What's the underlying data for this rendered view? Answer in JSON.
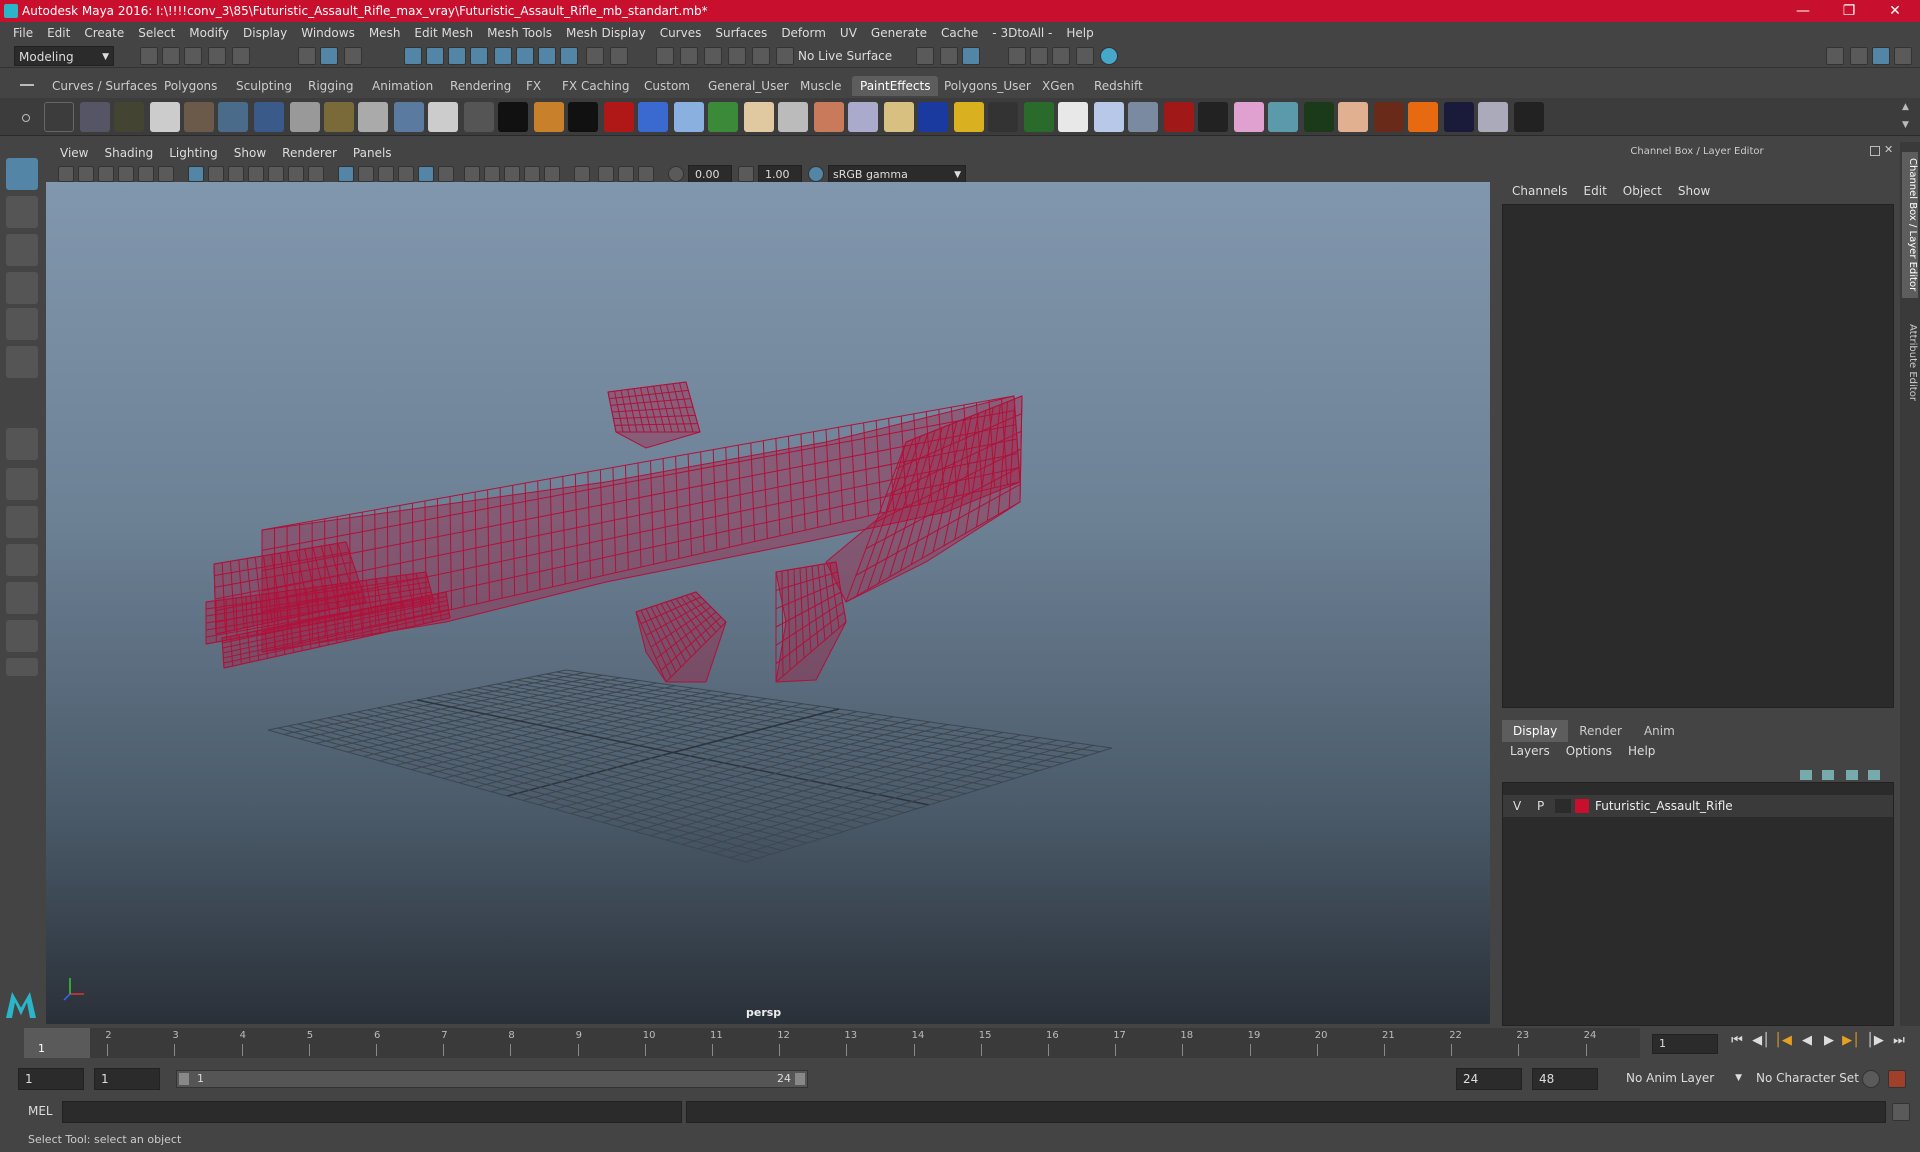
{
  "window": {
    "title": "Autodesk Maya 2016: I:\\!!!!conv_3\\85\\Futuristic_Assault_Rifle_max_vray\\Futuristic_Assault_Rifle_mb_standart.mb*"
  },
  "menus": [
    "File",
    "Edit",
    "Create",
    "Select",
    "Modify",
    "Display",
    "Windows",
    "Mesh",
    "Edit Mesh",
    "Mesh Tools",
    "Mesh Display",
    "Curves",
    "Surfaces",
    "Deform",
    "UV",
    "Generate",
    "Cache",
    "- 3DtoAll -",
    "Help"
  ],
  "statusline": {
    "mode": "Modeling",
    "live_surface": "No Live Surface"
  },
  "shelf_tabs": [
    "Curves / Surfaces",
    "Polygons",
    "Sculpting",
    "Rigging",
    "Animation",
    "Rendering",
    "FX",
    "FX Caching",
    "Custom",
    "General_User",
    "Muscle",
    "PaintEffects",
    "Polygons_User",
    "XGen",
    "Redshift"
  ],
  "shelf_active": "PaintEffects",
  "viewport": {
    "menus": [
      "View",
      "Shading",
      "Lighting",
      "Show",
      "Renderer",
      "Panels"
    ],
    "exposure": "0.00",
    "gamma": "1.00",
    "color_space": "sRGB gamma",
    "camera": "persp",
    "wire_color": "#b0103a"
  },
  "channel_box": {
    "title": "Channel Box / Layer Editor",
    "menus": [
      "Channels",
      "Edit",
      "Object",
      "Show"
    ]
  },
  "layer_editor": {
    "tabs": [
      "Display",
      "Render",
      "Anim"
    ],
    "menus": [
      "Layers",
      "Options",
      "Help"
    ],
    "layers": [
      {
        "v": "V",
        "p": "P",
        "color": "#c8102e",
        "name": "Futuristic_Assault_Rifle"
      }
    ]
  },
  "side_tabs": [
    "Channel Box / Layer Editor",
    "Attribute Editor"
  ],
  "timeline": {
    "ticks": [
      "1",
      "2",
      "3",
      "4",
      "5",
      "6",
      "7",
      "8",
      "9",
      "10",
      "11",
      "12",
      "13",
      "14",
      "15",
      "16",
      "17",
      "18",
      "19",
      "20",
      "21",
      "22",
      "23",
      "24"
    ],
    "current_frame_label": "1",
    "current_frame_field": "1"
  },
  "range": {
    "start": "1",
    "playback_start": "1",
    "slider_start": "1",
    "slider_end": "24",
    "playback_end": "24",
    "end": "48",
    "anim_layer": "No Anim Layer",
    "character_set": "No Character Set"
  },
  "cmdline": {
    "lang": "MEL"
  },
  "helpline": {
    "text": "Select Tool: select an object"
  }
}
